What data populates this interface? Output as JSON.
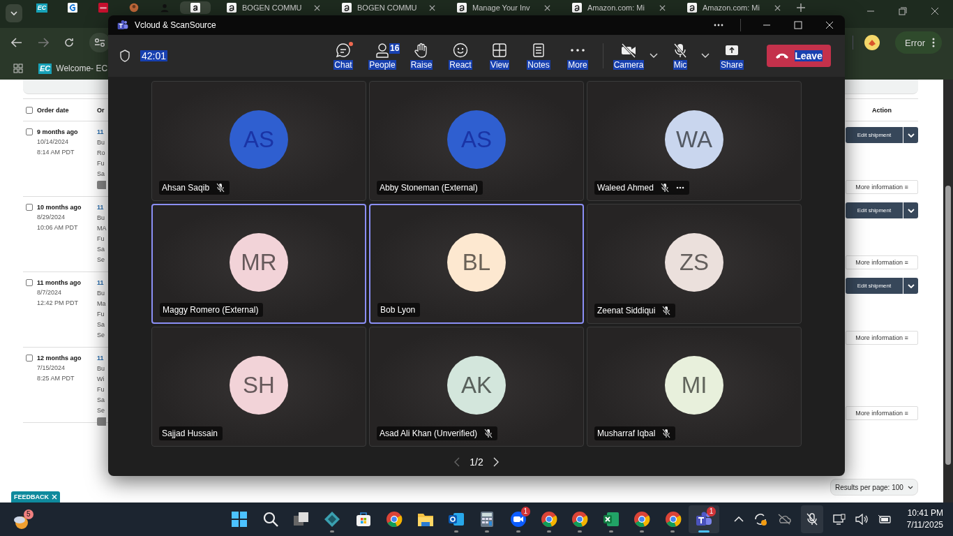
{
  "browser": {
    "pinned_tabs": [
      {
        "kind": "ec",
        "logo": "EC",
        "selected": false
      },
      {
        "kind": "g",
        "selected": false
      },
      {
        "kind": "red",
        "selected": false
      },
      {
        "kind": "orange",
        "selected": false
      },
      {
        "kind": "person",
        "selected": false
      },
      {
        "kind": "amazon",
        "selected": true
      }
    ],
    "tabs": [
      {
        "title": "BOGEN COMMU",
        "selected": false
      },
      {
        "title": "BOGEN COMMU",
        "selected": false
      },
      {
        "title": "Manage Your Inv",
        "selected": false
      },
      {
        "title": "Amazon.com: Mi",
        "selected": false
      },
      {
        "title": "Amazon.com: Mi",
        "selected": false
      }
    ],
    "profile_status": "Error",
    "bookmark": {
      "logo": "EC",
      "title": "Welcome- EC"
    }
  },
  "page": {
    "header": {
      "order_date": "Order date",
      "column_2": "Or",
      "action": "Action"
    },
    "rows": [
      {
        "checked": false,
        "age": "9 months ago",
        "date": "10/14/2024",
        "time": "8:14 AM PDT",
        "column_2": [
          "11",
          "Bu",
          "Ro",
          "Fu",
          "Sa"
        ],
        "tag": true,
        "edit": "Edit shipment",
        "more": "More information ≡"
      },
      {
        "checked": false,
        "age": "10 months ago",
        "date": "8/29/2024",
        "time": "10:06 AM PDT",
        "column_2": [
          "11",
          "Bu",
          "MA",
          "Fu",
          "Sa",
          "Se"
        ],
        "tag": false,
        "edit": "Edit shipment",
        "more": "More information ≡"
      },
      {
        "checked": false,
        "age": "11 months ago",
        "date": "8/7/2024",
        "time": "12:42 PM PDT",
        "column_2": [
          "11",
          "Bu",
          "Ma",
          "Fu",
          "Sa",
          "Se"
        ],
        "tag": false,
        "edit": "Edit shipment",
        "more": "More information ≡"
      },
      {
        "checked": false,
        "age": "12 months ago",
        "date": "7/15/2024",
        "time": "8:25 AM PDT",
        "column_2": [
          "11",
          "Bu",
          "Wi",
          "Fu",
          "Sa",
          "Se"
        ],
        "tag": true,
        "more": "More information ≡"
      }
    ],
    "header_checked": false,
    "results_per_page": "Results per page: 100",
    "feedback": "FEEDBACK"
  },
  "meeting": {
    "title": "Vcloud & ScanSource",
    "timer": "42:01",
    "controls": [
      {
        "kind": "chat",
        "label": "Chat",
        "dot": true
      },
      {
        "kind": "people",
        "label": "People",
        "badge": "16"
      },
      {
        "kind": "raise",
        "label": "Raise"
      },
      {
        "kind": "react",
        "label": "React"
      },
      {
        "kind": "view",
        "label": "View"
      },
      {
        "kind": "notes",
        "label": "Notes"
      },
      {
        "kind": "more",
        "label": "More"
      },
      {
        "kind": "camera",
        "label": "Camera",
        "menu": true
      },
      {
        "kind": "mic",
        "label": "Mic",
        "menu": true
      },
      {
        "kind": "share",
        "label": "Share"
      }
    ],
    "leave": "Leave",
    "participants": [
      {
        "initials": "AS",
        "name": "Ahsan Saqib",
        "color": "#2f5fd0",
        "muted": true,
        "speaking": false,
        "options": false
      },
      {
        "initials": "AS",
        "name": "Abby Stoneman (External)",
        "color": "#2f5fd0",
        "muted": false,
        "speaking": false,
        "options": false
      },
      {
        "initials": "WA",
        "name": "Waleed Ahmed",
        "color": "#c9d6ee",
        "muted": true,
        "speaking": false,
        "options": true
      },
      {
        "initials": "MR",
        "name": "Maggy Romero (External)",
        "color": "#f2d3d8",
        "muted": false,
        "speaking": true,
        "options": false
      },
      {
        "initials": "BL",
        "name": "Bob Lyon",
        "color": "#fde8d0",
        "muted": false,
        "speaking": true,
        "options": false
      },
      {
        "initials": "ZS",
        "name": "Zeenat Siddiqui",
        "color": "#ebe0dc",
        "muted": true,
        "speaking": false,
        "options": false
      },
      {
        "initials": "SH",
        "name": "Sajjad Hussain",
        "color": "#f2d3d8",
        "muted": false,
        "speaking": false,
        "options": false
      },
      {
        "initials": "AK",
        "name": "Asad Ali Khan (Unverified)",
        "color": "#d3e6dc",
        "muted": true,
        "speaking": false,
        "options": false
      },
      {
        "initials": "MI",
        "name": "Musharraf Iqbal",
        "color": "#e8f0dc",
        "muted": true,
        "speaking": false,
        "options": false
      }
    ],
    "pager": "1/2"
  },
  "taskbar": {
    "weather_badge": "5",
    "apps": [
      {
        "kind": "start",
        "running": false,
        "selected": false
      },
      {
        "kind": "search",
        "running": false,
        "selected": false
      },
      {
        "kind": "taskview",
        "running": false,
        "selected": false
      },
      {
        "kind": "diamond",
        "running": true,
        "selected": false
      },
      {
        "kind": "store",
        "running": false,
        "selected": false
      },
      {
        "kind": "chrome",
        "running": false,
        "selected": false
      },
      {
        "kind": "files",
        "running": false,
        "selected": false
      },
      {
        "kind": "outlook",
        "running": true,
        "selected": false
      },
      {
        "kind": "calculator",
        "running": true,
        "selected": false
      },
      {
        "kind": "zoom",
        "badge": "1",
        "running": true,
        "selected": false
      },
      {
        "kind": "chrome",
        "running": true,
        "selected": false
      },
      {
        "kind": "chrome",
        "running": true,
        "selected": false
      },
      {
        "kind": "excel",
        "running": true,
        "selected": false
      },
      {
        "kind": "chrome",
        "running": true,
        "selected": false
      },
      {
        "kind": "chrome",
        "running": true,
        "selected": false
      },
      {
        "kind": "teams",
        "badge": "1",
        "running": true,
        "selected": true
      }
    ],
    "time": "10:41 PM",
    "date": "7/11/2025"
  }
}
